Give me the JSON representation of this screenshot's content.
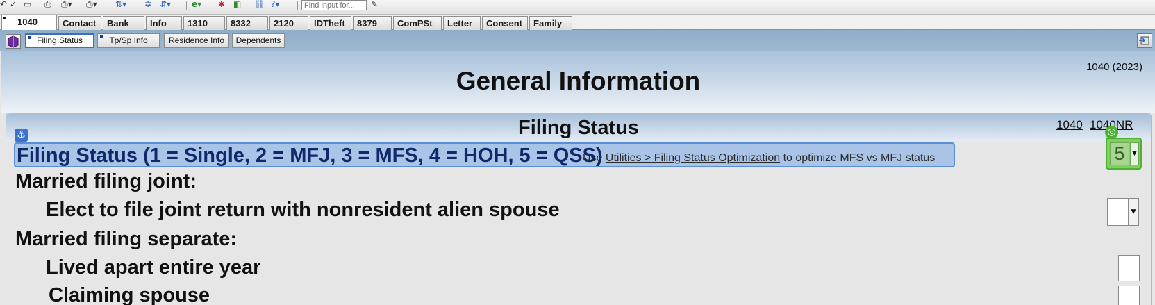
{
  "toolbar": {
    "find_placeholder": "Find input for...",
    "icons": [
      "undo-icon",
      "checkmark-icon",
      "form-icon",
      "print-icon",
      "print-options-icon",
      "printer-icon",
      "sort-icon",
      "tools-icon",
      "sort-desc-icon",
      "browser-icon",
      "bookmark-icon",
      "import-icon",
      "network-icon",
      "help-icon",
      "edit-icon"
    ]
  },
  "form_tabs": [
    "1040",
    "Contact",
    "Bank",
    "Info",
    "1310",
    "8332",
    "2120",
    "IDTheft",
    "8379",
    "ComPSt",
    "Letter",
    "Consent",
    "Family"
  ],
  "active_form_tab": "1040",
  "sub_tabs": [
    "Filing Status",
    "Tp/Sp Info",
    "Residence Info",
    "Dependents"
  ],
  "active_sub_tab": "Filing Status",
  "header": {
    "title": "General Information",
    "form_year": "1040 (2023)"
  },
  "section": {
    "title": "Filing Status",
    "links": [
      "1040",
      "1040NR"
    ]
  },
  "filing_status": {
    "label": "Filing Status (1 = Single, 2 = MFJ, 3 = MFS, 4 = HOH, 5 = QSS)",
    "hint_prefix": "Use",
    "hint_link": "Utilities > Filing Status Optimization",
    "hint_suffix": "to optimize MFS vs MFJ status",
    "value": "5"
  },
  "rows": {
    "mfj_heading": "Married filing joint:",
    "elect_joint": "Elect to file joint return with nonresident alien spouse",
    "mfs_heading": "Married filing separate:",
    "lived_apart": "Lived apart entire year",
    "claiming_spouse": "Claiming spouse"
  },
  "colors": {
    "accent": "#3c73cc",
    "highlight": "#a9c4e7",
    "selected_field": "#7fcf5d"
  }
}
